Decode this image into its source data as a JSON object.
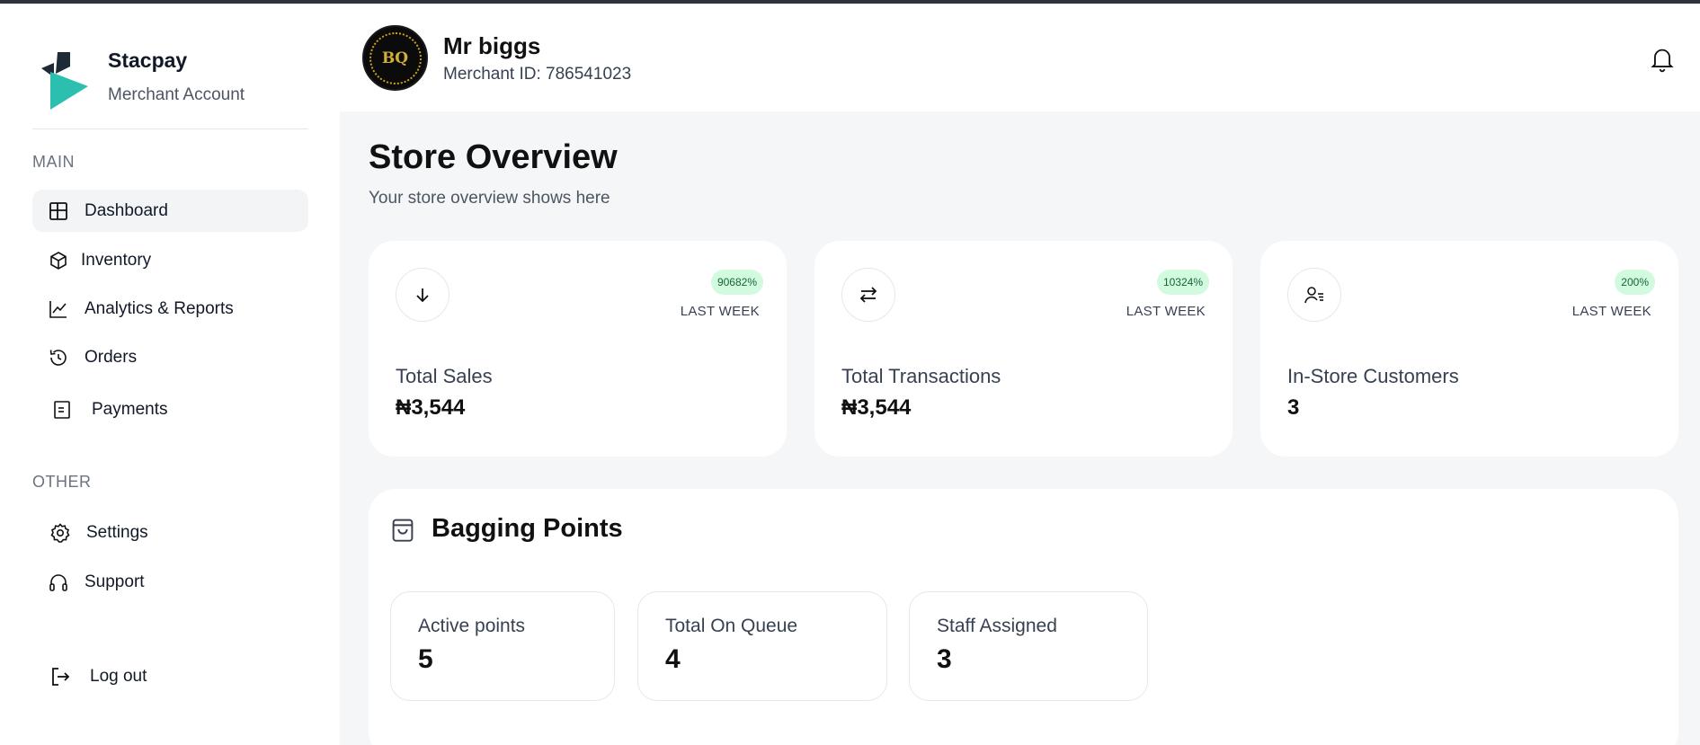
{
  "brand": {
    "name": "Stacpay",
    "subtitle": "Merchant Account"
  },
  "sidebar": {
    "main_label": "MAIN",
    "other_label": "OTHER",
    "main_items": [
      {
        "label": "Dashboard",
        "icon": "grid-icon",
        "active": true
      },
      {
        "label": "Inventory",
        "icon": "box-icon"
      },
      {
        "label": "Analytics & Reports",
        "icon": "chart-line-icon"
      },
      {
        "label": "Orders",
        "icon": "history-icon"
      },
      {
        "label": "Payments",
        "icon": "document-icon"
      }
    ],
    "other_items": [
      {
        "label": "Settings",
        "icon": "gear-icon"
      },
      {
        "label": "Support",
        "icon": "headphones-icon"
      }
    ],
    "logout_label": "Log out"
  },
  "header": {
    "merchant_name": "Mr biggs",
    "merchant_id": "Merchant ID: 786541023",
    "avatar_text": "BQ"
  },
  "overview": {
    "title": "Store Overview",
    "subtitle": "Your store overview shows here"
  },
  "stats": [
    {
      "label": "Total Sales",
      "value": "₦3,544",
      "change": "90682%",
      "period": "LAST WEEK",
      "icon": "arrow-down-icon"
    },
    {
      "label": "Total Transactions",
      "value": "₦3,544",
      "change": "10324%",
      "period": "LAST WEEK",
      "icon": "swap-arrows-icon"
    },
    {
      "label": "In-Store Customers",
      "value": "3",
      "change": "200%",
      "period": "LAST WEEK",
      "icon": "user-list-icon"
    }
  ],
  "bagging": {
    "title": "Bagging Points",
    "cards": [
      {
        "label": "Active points",
        "value": "5"
      },
      {
        "label": "Total On Queue",
        "value": "4"
      },
      {
        "label": "Staff Assigned",
        "value": "3"
      }
    ]
  },
  "colors": {
    "accent": "#2bbfb0",
    "badge_bg": "#d1fadf",
    "badge_text": "#166534",
    "main_bg": "#f5f6f7"
  }
}
